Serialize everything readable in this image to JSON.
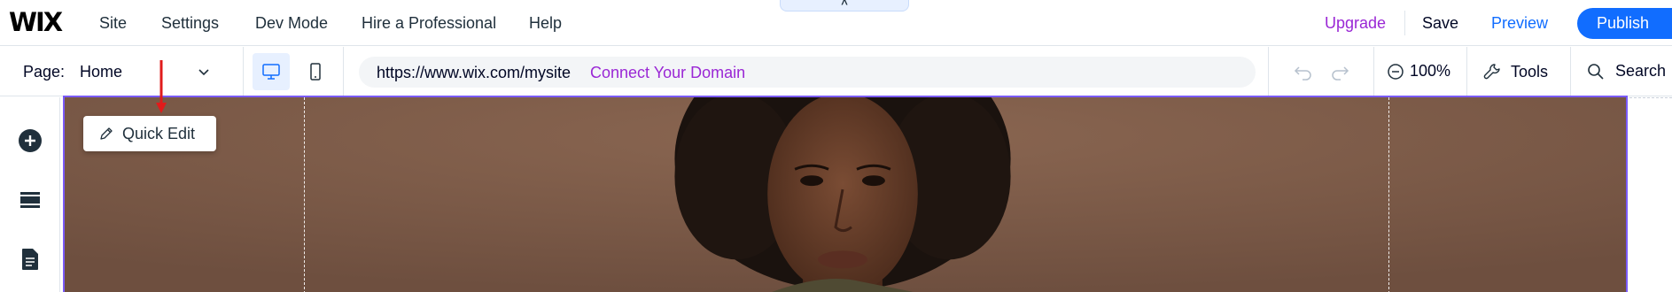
{
  "app": {
    "logo": "WIX"
  },
  "topbar": {
    "menu": [
      "Site",
      "Settings",
      "Dev Mode",
      "Hire a Professional",
      "Help"
    ],
    "collapse_icon": "^",
    "upgrade": "Upgrade",
    "save": "Save",
    "preview": "Preview",
    "publish": "Publish"
  },
  "pagebar": {
    "page_label": "Page:",
    "page_value": "Home",
    "url": "https://www.wix.com/mysite",
    "connect_domain": "Connect Your Domain",
    "zoom": "100%",
    "tools": "Tools",
    "search": "Search",
    "active_device": "desktop"
  },
  "left_panel": {
    "icons": [
      "add-elements-icon",
      "sections-icon",
      "pages-icon"
    ]
  },
  "canvas": {
    "quick_edit": "Quick Edit",
    "annotation": "red-arrow-pointing-down",
    "selection_color": "#7a5af8"
  },
  "colors": {
    "accent": "#116dff",
    "upgrade": "#9a27d5",
    "selection": "#7a5af8",
    "annotation": "#e01b1b"
  }
}
